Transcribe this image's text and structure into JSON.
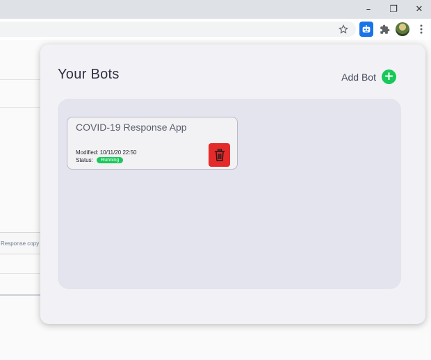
{
  "browser": {
    "window_controls": {
      "minimize": "–",
      "restore": "❐",
      "close": "✕"
    },
    "toolbar_icons": [
      "star-icon",
      "bot-extension-icon",
      "puzzle-icon",
      "avatar",
      "kebab-menu-icon"
    ],
    "accent": "#1a73e8"
  },
  "background_page": {
    "table_cell_text": "Response copy"
  },
  "popup": {
    "title": "Your Bots",
    "add_bot_label": "Add Bot",
    "add_icon": "+",
    "bots": [
      {
        "name": "COVID-19 Response App",
        "modified_label": "Modified:",
        "modified_value": "10/11/20 22:50",
        "status_label": "Status:",
        "status_value": "Running",
        "status_color": "#19c85a",
        "delete_color": "#e52a2a"
      }
    ]
  }
}
